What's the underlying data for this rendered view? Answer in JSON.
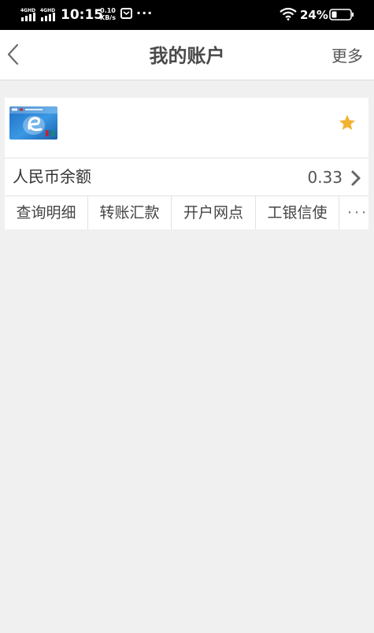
{
  "status_bar": {
    "signal1_label": "4G",
    "signal2_label": "4G",
    "time": "10:15",
    "speed_value": "0.10",
    "speed_unit": "KB/s",
    "overflow": "···",
    "battery_text": "24%"
  },
  "nav": {
    "title": "我的账户",
    "more_label": "更多",
    "back_icon": "chevron-left-icon"
  },
  "account_card": {
    "card_image": "e-card-thumbnail",
    "favorite_icon": "star-icon",
    "favorite_color": "#f2b233",
    "balance_label": "人民币余额",
    "balance_value": "0.33",
    "actions": [
      {
        "label": "查询明细"
      },
      {
        "label": "转账汇款"
      },
      {
        "label": "开户网点"
      },
      {
        "label": "工银信使"
      },
      {
        "label": "···"
      }
    ]
  }
}
